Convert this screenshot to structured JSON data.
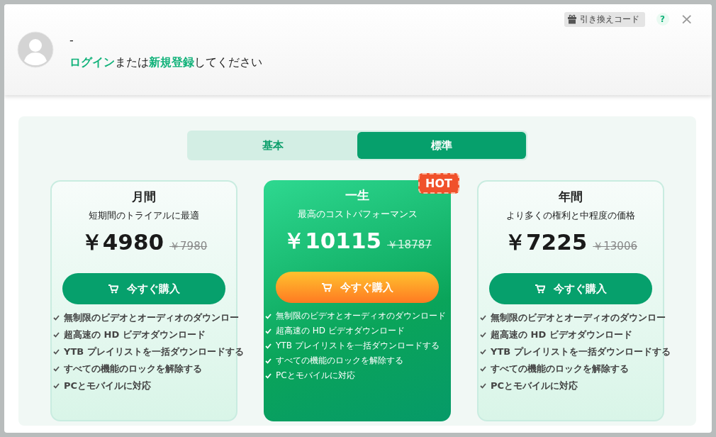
{
  "header": {
    "username": "-",
    "prompt": "**ログイン**または**新規登録**してください",
    "redeem": "引き換えコード",
    "help": "?",
    "close": "×"
  },
  "tabs": [
    {
      "label": "基本",
      "selected": false
    },
    {
      "label": "標準",
      "selected": true
    }
  ],
  "plans": [
    {
      "name": "月間",
      "tagline": "短期間のトライアルに最適",
      "price": "￥4980",
      "old_price": "￥7980",
      "featured": false,
      "button": "今すぐ購入",
      "features": [
        "無制限のビデオとオーディオのダウンロー",
        "超高速の HD ビデオダウンロード",
        "YTB プレイリストを一括ダウンロードする",
        "すべての機能のロックを解除する",
        "PCとモバイルに対応"
      ]
    },
    {
      "name": "一生",
      "tagline": "最高のコストパフォーマンス",
      "price": "￥10115",
      "old_price": "￥18787",
      "featured": true,
      "badge": "HOT",
      "button": "今すぐ購入",
      "features": [
        "無制限のビデオとオーディオのダウンロード",
        "超高速の HD ビデオダウンロード",
        "YTB プレイリストを一括ダウンロードする",
        "すべての機能のロックを解除する",
        "PCとモバイルに対応"
      ]
    },
    {
      "name": "年間",
      "tagline": "より多くの権利と中程度の価格",
      "price": "￥7225",
      "old_price": "￥13006",
      "featured": false,
      "button": "今すぐ購入",
      "features": [
        "無制限のビデオとオーディオのダウンロー",
        "超高速の HD ビデオダウンロード",
        "YTB プレイリストを一括ダウンロードする",
        "すべての機能のロックを解除する",
        "PCとモバイルに対応"
      ]
    }
  ]
}
